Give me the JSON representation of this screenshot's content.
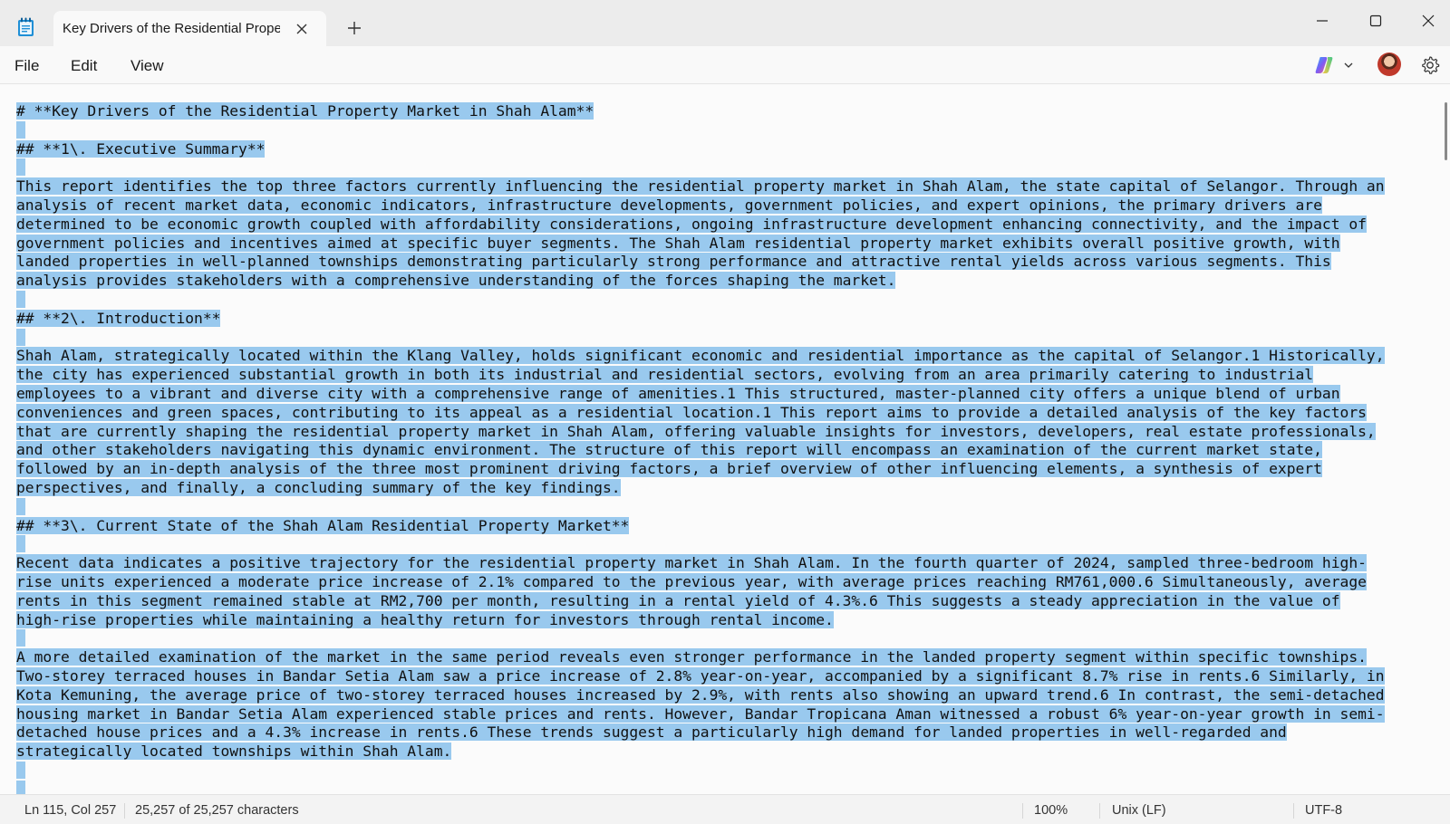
{
  "window": {
    "tab_title": "Key Drivers of the Residential Property Market in Shah Alam",
    "controls": {
      "minimize": "minimize",
      "maximize": "maximize",
      "close": "close"
    }
  },
  "menu": {
    "items": [
      {
        "label": "File"
      },
      {
        "label": "Edit"
      },
      {
        "label": "View"
      }
    ]
  },
  "document": {
    "lines": [
      "# **Key Drivers of the Residential Property Market in Shah Alam**",
      "",
      "## **1\\. Executive Summary**",
      "",
      "This report identifies the top three factors currently influencing the residential property market in Shah Alam, the state capital of Selangor. Through an",
      "analysis of recent market data, economic indicators, infrastructure developments, government policies, and expert opinions, the primary drivers are",
      "determined to be economic growth coupled with affordability considerations, ongoing infrastructure development enhancing connectivity, and the impact of",
      "government policies and incentives aimed at specific buyer segments. The Shah Alam residential property market exhibits overall positive growth, with",
      "landed properties in well-planned townships demonstrating particularly strong performance and attractive rental yields across various segments. This",
      "analysis provides stakeholders with a comprehensive understanding of the forces shaping the market.",
      "",
      "## **2\\. Introduction**",
      "",
      "Shah Alam, strategically located within the Klang Valley, holds significant economic and residential importance as the capital of Selangor.1 Historically,",
      "the city has experienced substantial growth in both its industrial and residential sectors, evolving from an area primarily catering to industrial",
      "employees to a vibrant and diverse city with a comprehensive range of amenities.1 This structured, master-planned city offers a unique blend of urban",
      "conveniences and green spaces, contributing to its appeal as a residential location.1 This report aims to provide a detailed analysis of the key factors",
      "that are currently shaping the residential property market in Shah Alam, offering valuable insights for investors, developers, real estate professionals,",
      "and other stakeholders navigating this dynamic environment. The structure of this report will encompass an examination of the current market state,",
      "followed by an in-depth analysis of the three most prominent driving factors, a brief overview of other influencing elements, a synthesis of expert",
      "perspectives, and finally, a concluding summary of the key findings.",
      "",
      "## **3\\. Current State of the Shah Alam Residential Property Market**",
      "",
      "Recent data indicates a positive trajectory for the residential property market in Shah Alam. In the fourth quarter of 2024, sampled three-bedroom high-",
      "rise units experienced a moderate price increase of 2.1% compared to the previous year, with average prices reaching RM761,000.6 Simultaneously, average",
      "rents in this segment remained stable at RM2,700 per month, resulting in a rental yield of 4.3%.6 This suggests a steady appreciation in the value of",
      "high-rise properties while maintaining a healthy return for investors through rental income.",
      "",
      "A more detailed examination of the market in the same period reveals even stronger performance in the landed property segment within specific townships.",
      "Two-storey terraced houses in Bandar Setia Alam saw a price increase of 2.8% year-on-year, accompanied by a significant 8.7% rise in rents.6 Similarly, in",
      "Kota Kemuning, the average price of two-storey terraced houses increased by 2.9%, with rents also showing an upward trend.6 In contrast, the semi-detached",
      "housing market in Bandar Setia Alam experienced stable prices and rents. However, Bandar Tropicana Aman witnessed a robust 6% year-on-year growth in semi-",
      "detached house prices and a 4.3% increase in rents.6 These trends suggest a particularly high demand for landed properties in well-regarded and",
      "strategically located townships within Shah Alam.",
      "",
      ""
    ]
  },
  "status": {
    "position": "Ln 115, Col 257",
    "characters": "25,257 of 25,257 characters",
    "zoom": "100%",
    "line_ending": "Unix (LF)",
    "encoding": "UTF-8"
  }
}
